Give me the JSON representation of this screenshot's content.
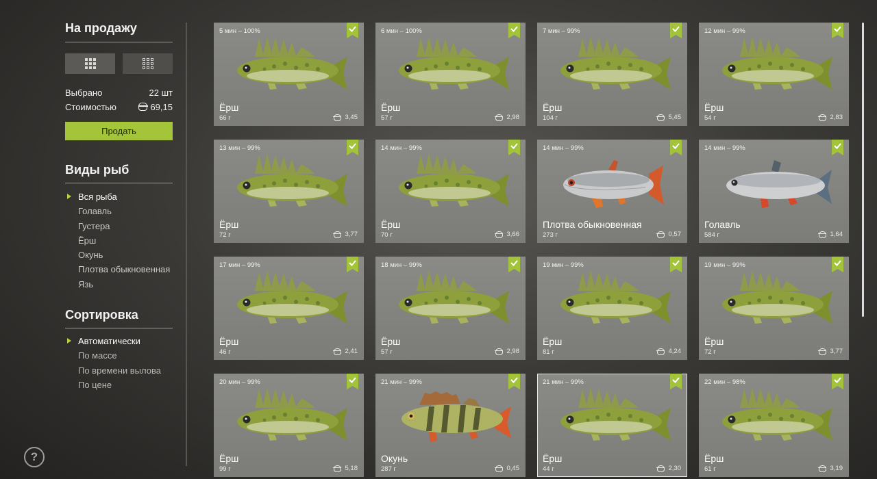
{
  "sidebar": {
    "for_sale_title": "На продажу",
    "selected_label": "Выбрано",
    "selected_value": "22 шт",
    "cost_label": "Стоимостью",
    "cost_value": "69,15",
    "sell_button": "Продать",
    "fish_types_title": "Виды рыб",
    "fish_types": [
      "Вся рыба",
      "Голавль",
      "Густера",
      "Ёрш",
      "Окунь",
      "Плотва обыкновенная",
      "Язь"
    ],
    "fish_types_active": 0,
    "sort_title": "Сортировка",
    "sort_options": [
      "Автоматически",
      "По массе",
      "По времени вылова",
      "По цене"
    ],
    "sort_active": 0,
    "help": "?"
  },
  "colors": {
    "accent": "#a4c53a",
    "card_bg": "#848480"
  },
  "fish": [
    {
      "time": "5 мин – 100%",
      "name": "Ёрш",
      "weight": "66 г",
      "price": "3,45",
      "kind": "ruffe"
    },
    {
      "time": "6 мин – 100%",
      "name": "Ёрш",
      "weight": "57 г",
      "price": "2,98",
      "kind": "ruffe"
    },
    {
      "time": "7 мин – 99%",
      "name": "Ёрш",
      "weight": "104 г",
      "price": "5,45",
      "kind": "ruffe"
    },
    {
      "time": "12 мин – 99%",
      "name": "Ёрш",
      "weight": "54 г",
      "price": "2,83",
      "kind": "ruffe"
    },
    {
      "time": "13 мин – 99%",
      "name": "Ёрш",
      "weight": "72 г",
      "price": "3,77",
      "kind": "ruffe"
    },
    {
      "time": "14 мин – 99%",
      "name": "Ёрш",
      "weight": "70 г",
      "price": "3,66",
      "kind": "ruffe"
    },
    {
      "time": "14 мин – 99%",
      "name": "Плотва обыкновенная",
      "weight": "273 г",
      "price": "0,57",
      "kind": "roach"
    },
    {
      "time": "14 мин – 99%",
      "name": "Голавль",
      "weight": "584 г",
      "price": "1,64",
      "kind": "chub"
    },
    {
      "time": "17 мин – 99%",
      "name": "Ёрш",
      "weight": "46 г",
      "price": "2,41",
      "kind": "ruffe"
    },
    {
      "time": "18 мин – 99%",
      "name": "Ёрш",
      "weight": "57 г",
      "price": "2,98",
      "kind": "ruffe"
    },
    {
      "time": "19 мин – 99%",
      "name": "Ёрш",
      "weight": "81 г",
      "price": "4,24",
      "kind": "ruffe"
    },
    {
      "time": "19 мин – 99%",
      "name": "Ёрш",
      "weight": "72 г",
      "price": "3,77",
      "kind": "ruffe"
    },
    {
      "time": "20 мин – 99%",
      "name": "Ёрш",
      "weight": "99 г",
      "price": "5,18",
      "kind": "ruffe"
    },
    {
      "time": "21 мин – 99%",
      "name": "Окунь",
      "weight": "287 г",
      "price": "0,45",
      "kind": "perch"
    },
    {
      "time": "21 мин – 99%",
      "name": "Ёрш",
      "weight": "44 г",
      "price": "2,30",
      "kind": "ruffe",
      "selected": true
    },
    {
      "time": "22 мин – 98%",
      "name": "Ёрш",
      "weight": "61 г",
      "price": "3,19",
      "kind": "ruffe"
    }
  ]
}
